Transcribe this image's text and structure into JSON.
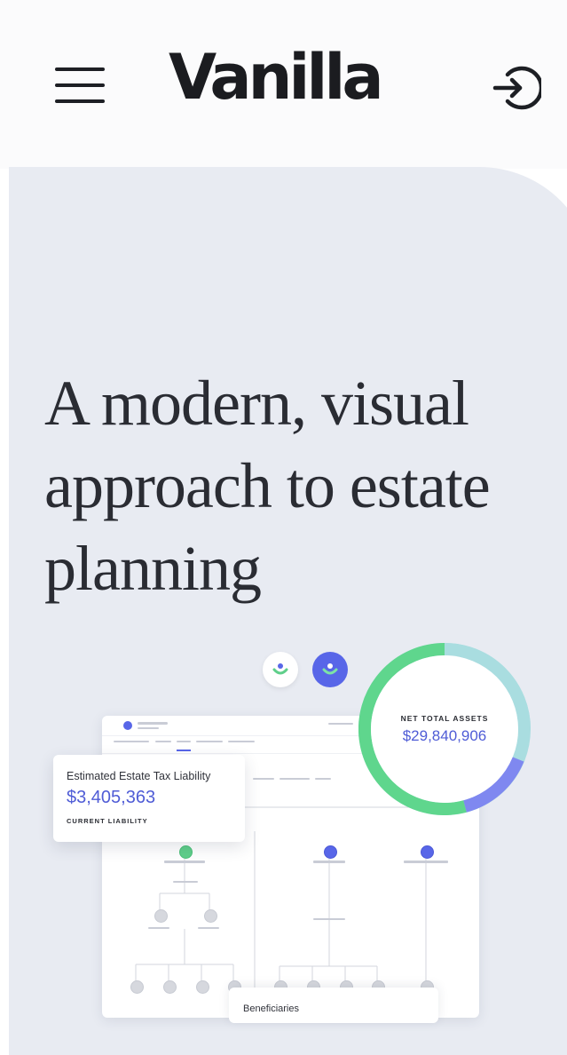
{
  "header": {
    "logo_text": "Vanilla",
    "menu_icon": "hamburger-menu-icon",
    "login_icon": "sign-in-arrow-icon"
  },
  "hero": {
    "title": "A modern, visual approach to estate planning"
  },
  "illustration": {
    "liability_card": {
      "label": "Estimated Estate Tax Liability",
      "amount": "$3,405,363",
      "sublabel": "CURRENT LIABILITY"
    },
    "assets_ring": {
      "label": "NET TOTAL ASSETS",
      "amount": "$29,840,906"
    },
    "beneficiaries_card": {
      "label": "Beneficiaries"
    }
  },
  "colors": {
    "accent_blue": "#5866e8",
    "accent_green": "#5fcf8a",
    "hero_bg": "#e8ebf2"
  }
}
